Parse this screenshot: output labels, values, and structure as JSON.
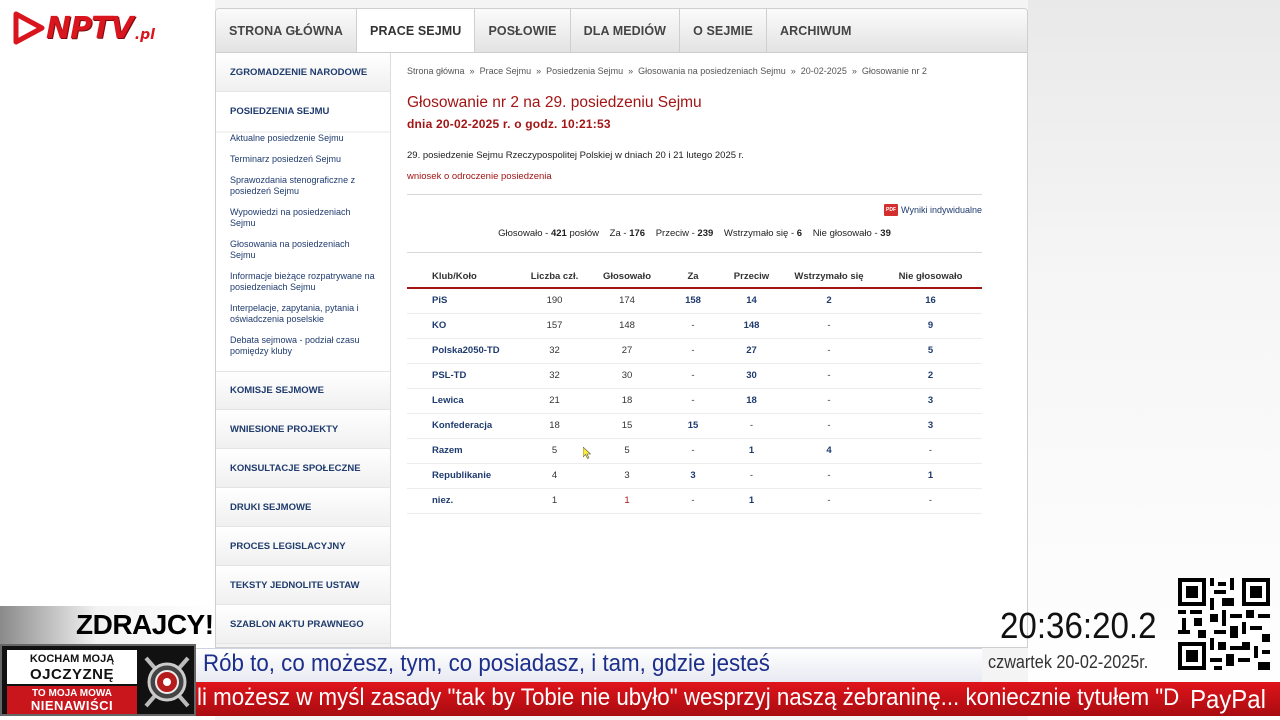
{
  "logo": {
    "text": "NPTV",
    "suffix": ".pl"
  },
  "topnav": [
    {
      "label": "STRONA GŁÓWNA",
      "active": false
    },
    {
      "label": "PRACE SEJMU",
      "active": true
    },
    {
      "label": "POSŁOWIE",
      "active": false
    },
    {
      "label": "DLA MEDIÓW",
      "active": false
    },
    {
      "label": "O SEJMIE",
      "active": false
    },
    {
      "label": "ARCHIWUM",
      "active": false
    }
  ],
  "sidebar": {
    "zgromadzenie": "ZGROMADZENIE NARODOWE",
    "posiedzenia": "POSIEDZENIA SEJMU",
    "sub_links": [
      "Aktualne posiedzenie Sejmu",
      "Terminarz posiedzeń Sejmu",
      "Sprawozdania stenograficzne z posiedzeń Sejmu",
      "Wypowiedzi na posiedzeniach Sejmu",
      "Głosowania na posiedzeniach Sejmu",
      "Informacje bieżące rozpatrywane na posiedzeniach Sejmu",
      "Interpelacje, zapytania, pytania i oświadczenia poselskie",
      "Debata sejmowa - podział czasu pomiędzy kluby"
    ],
    "sections": [
      "KOMISJE SEJMOWE",
      "WNIESIONE PROJEKTY",
      "KONSULTACJE SPOŁECZNE",
      "DRUKI SEJMOWE",
      "PROCES LEGISLACYJNY",
      "TEKSTY JEDNOLITE USTAW",
      "SZABLON AKTU PRAWNEGO"
    ]
  },
  "breadcrumb": [
    "Strona główna",
    "Prace Sejmu",
    "Posiedzenia Sejmu",
    "Głosowania na posiedzeniach Sejmu",
    "20-02-2025",
    "Głosowanie nr 2"
  ],
  "breadcrumb_sep": "»",
  "content": {
    "title": "Głosowanie nr 2 na 29. posiedzeniu Sejmu",
    "subtitle": "dnia 20-02-2025 r. o godz. 10:21:53",
    "description": "29. posiedzenie Sejmu Rzeczypospolitej Polskiej w dniach 20 i 21 lutego 2025 r.",
    "motion": "wniosek o odroczenie posiedzenia",
    "individual_results": "Wyniki indywidualne",
    "pdf_label": "PDF"
  },
  "summary": {
    "voted_label": "Głosowało -",
    "voted": "421",
    "voted_unit": "posłów",
    "za_label": "Za -",
    "za": "176",
    "przeciw_label": "Przeciw -",
    "przeciw": "239",
    "wstrzymalo_label": "Wstrzymało się -",
    "wstrzymalo": "6",
    "nie_label": "Nie głosowało -",
    "nie": "39"
  },
  "table": {
    "headers": [
      "Klub/Koło",
      "Liczba czł.",
      "Głosowało",
      "Za",
      "Przeciw",
      "Wstrzymało się",
      "Nie głosowało"
    ],
    "rows": [
      [
        "PiS",
        "190",
        "174",
        "158",
        "14",
        "2",
        "16"
      ],
      [
        "KO",
        "157",
        "148",
        "-",
        "148",
        "-",
        "9"
      ],
      [
        "Polska2050-TD",
        "32",
        "27",
        "-",
        "27",
        "-",
        "5"
      ],
      [
        "PSL-TD",
        "32",
        "30",
        "-",
        "30",
        "-",
        "2"
      ],
      [
        "Lewica",
        "21",
        "18",
        "-",
        "18",
        "-",
        "3"
      ],
      [
        "Konfederacja",
        "18",
        "15",
        "15",
        "-",
        "-",
        "3"
      ],
      [
        "Razem",
        "5",
        "5",
        "-",
        "1",
        "4",
        "-"
      ],
      [
        "Republikanie",
        "4",
        "3",
        "3",
        "-",
        "-",
        "1"
      ],
      [
        "niez.",
        "1",
        "1",
        "-",
        "1",
        "-",
        "-"
      ]
    ]
  },
  "overlay": {
    "headline": "ZDRAJCY!",
    "clock": "20:36:20.2",
    "date": "czwartek 20-02-2025r.",
    "ticker_blue": "Rób to, co możesz, tym, co posiadasz, i tam, gdzie jesteś",
    "ticker_red": "li możesz w myśl zasady \"tak by Tobie nie ubyło\" wesprzyj naszą żebraninę... koniecznie tytułem \"Darowizna\"",
    "paypal": "PayPal",
    "badge_line1": "KOCHAM MOJĄ",
    "badge_line2": "OJCZYZNĘ",
    "badge_line3": "TO MOJA MOWA",
    "badge_line4": "NIENAWIŚCI"
  },
  "colors": {
    "brand_red": "#a31515",
    "link_blue": "#1f3b6e",
    "ticker_red": "#d0121a",
    "ticker_blue_text": "#1c2f8a"
  }
}
